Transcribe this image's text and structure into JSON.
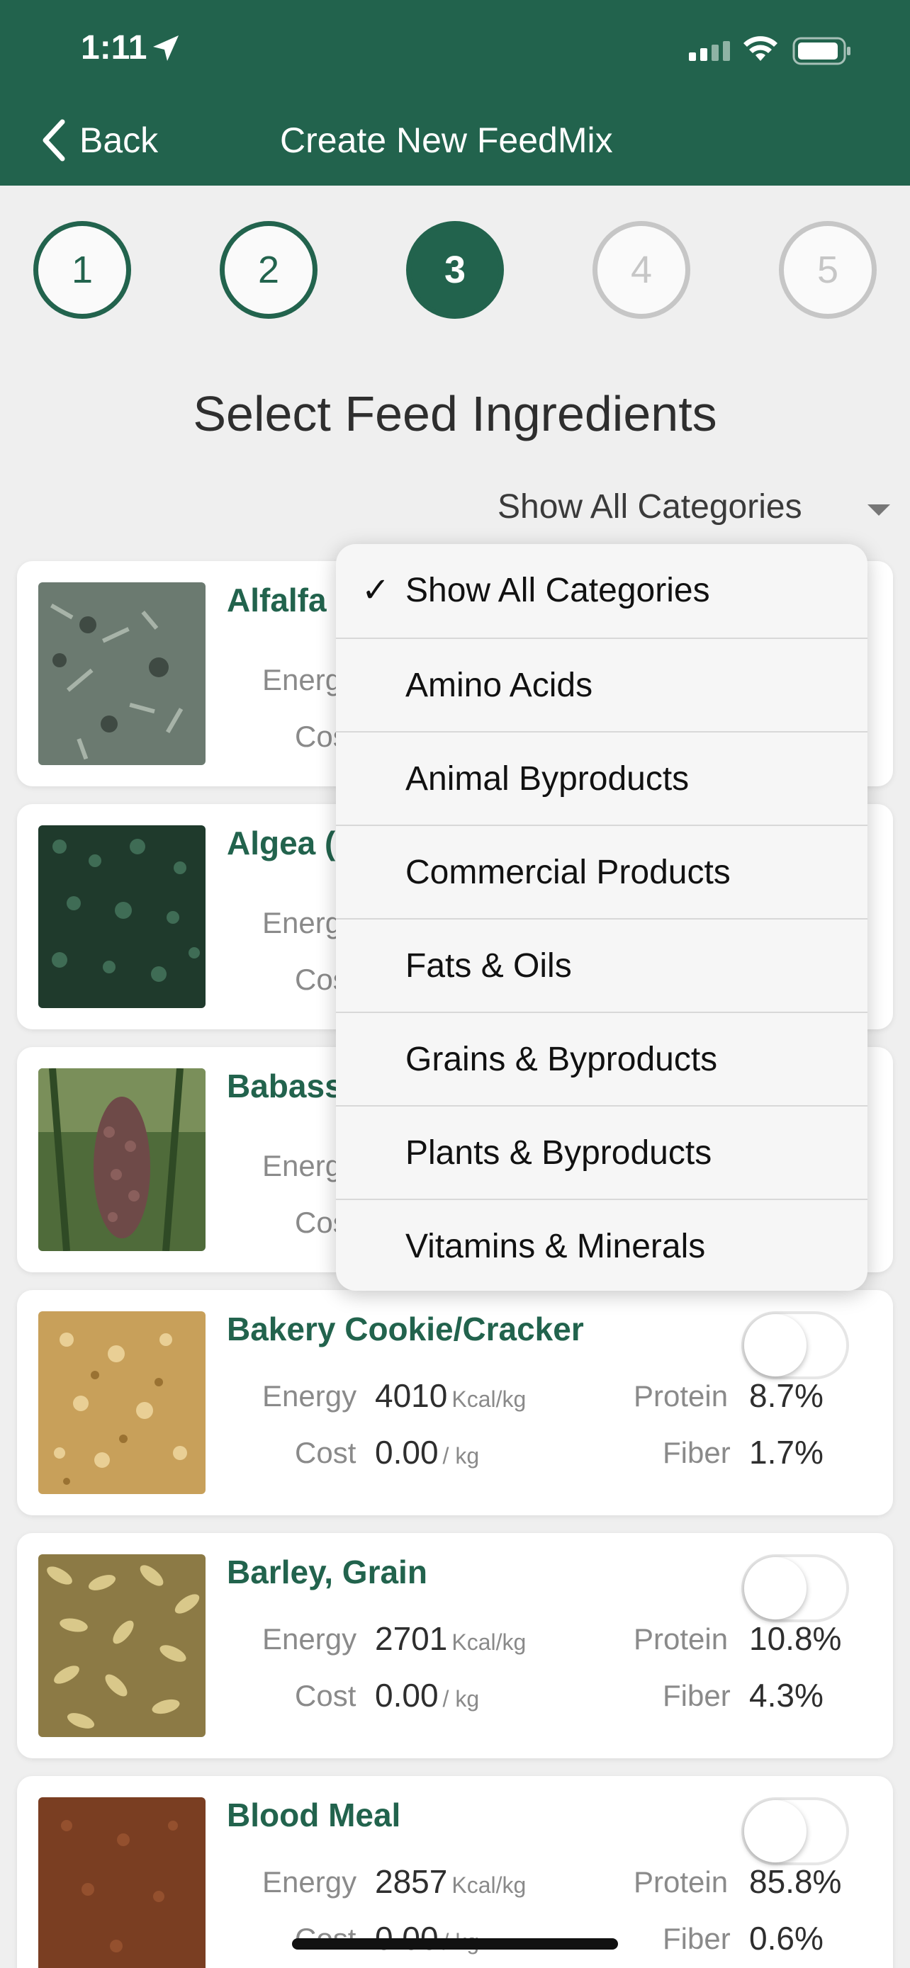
{
  "status_bar": {
    "time": "1:11"
  },
  "nav": {
    "back_label": "Back",
    "title": "Create New FeedMix"
  },
  "steps": [
    "1",
    "2",
    "3",
    "4",
    "5"
  ],
  "page": {
    "title": "Select Feed Ingredients",
    "category_filter": "Show All Categories"
  },
  "dropdown": {
    "items": [
      "Show All Categories",
      "Amino Acids",
      "Animal Byproducts",
      "Commercial Products",
      "Fats & Oils",
      "Grains & Byproducts",
      "Plants & Byproducts",
      "Vitamins & Minerals"
    ],
    "selected_check": "✓"
  },
  "labels": {
    "energy": "Energy",
    "cost": "Cost",
    "protein": "Protein",
    "fiber": "Fiber",
    "energy_unit": "Kcal/kg",
    "cost_unit": "/ kg"
  },
  "ingredients": [
    {
      "name": "Alfalfa",
      "energy_label": "Energ",
      "cost_label": "Cos"
    },
    {
      "name": "Algea (",
      "energy_label": "Energ",
      "cost_label": "Cos"
    },
    {
      "name": "Babass",
      "energy_label": "Energ",
      "cost_label": "Cos"
    },
    {
      "name": "Bakery Cookie/Cracker",
      "energy": "4010",
      "cost": "0.00",
      "protein": "8.7%",
      "fiber": "1.7%"
    },
    {
      "name": "Barley, Grain",
      "energy": "2701",
      "cost": "0.00",
      "protein": "10.8%",
      "fiber": "4.3%"
    },
    {
      "name": "Blood Meal",
      "energy": "2857",
      "cost": "0.00",
      "protein": "85.8%",
      "fiber": "0.6%"
    }
  ]
}
